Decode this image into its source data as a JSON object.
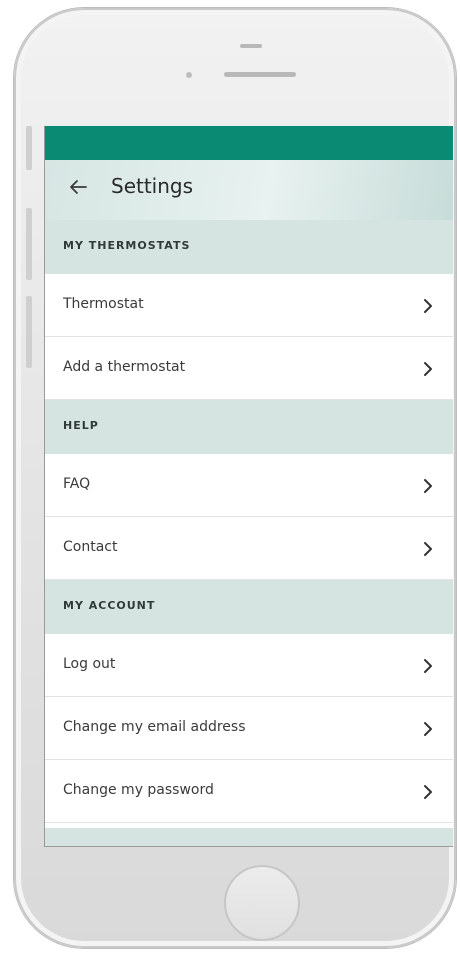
{
  "header": {
    "title": "Settings",
    "back_icon": "arrow-left-icon"
  },
  "sections": [
    {
      "title": "MY THERMOSTATS",
      "items": [
        {
          "label": "Thermostat",
          "icon": "chevron-right-icon"
        },
        {
          "label": "Add a thermostat",
          "icon": "chevron-right-icon"
        }
      ]
    },
    {
      "title": "HELP",
      "items": [
        {
          "label": "FAQ",
          "icon": "chevron-right-icon"
        },
        {
          "label": "Contact",
          "icon": "chevron-right-icon"
        }
      ]
    },
    {
      "title": "MY ACCOUNT",
      "items": [
        {
          "label": "Log out",
          "icon": "chevron-right-icon"
        },
        {
          "label": "Change my email address",
          "icon": "chevron-right-icon"
        },
        {
          "label": "Change my password",
          "icon": "chevron-right-icon"
        }
      ]
    }
  ],
  "colors": {
    "status_bar": "#0a8a73",
    "section_header": "#d5e4e0",
    "app_bar": "#e8f2f0"
  }
}
